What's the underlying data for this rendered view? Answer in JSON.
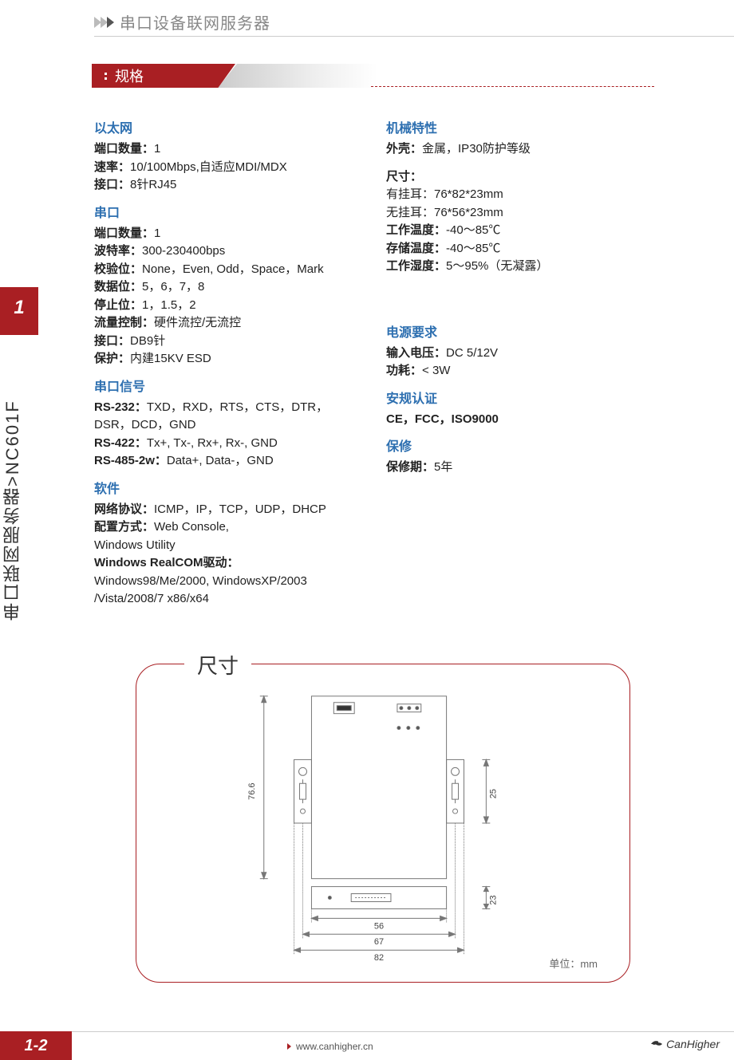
{
  "header": {
    "breadcrumb": "串口设备联网服务器"
  },
  "banner": {
    "title": "规格"
  },
  "sidebar": {
    "chapter": "1",
    "label": "串口联网服务器>NC601F"
  },
  "left": {
    "ethernet": {
      "h": "以太网",
      "l1_label": "端口数量：",
      "l1": "1",
      "l2_label": "速率：",
      "l2": "10/100Mbps,自适应MDI/MDX",
      "l3_label": "接口：",
      "l3": "8针RJ45"
    },
    "serial": {
      "h": "串口",
      "l1_label": "端口数量：",
      "l1": "1",
      "l2_label": "波特率：",
      "l2": "300-230400bps",
      "l3_label": "校验位：",
      "l3": "None，Even, Odd，Space，Mark",
      "l4_label": "数据位：",
      "l4": "5，6，7，8",
      "l5_label": "停止位：",
      "l5": "1，1.5，2",
      "l6_label": "流量控制：",
      "l6": "硬件流控/无流控",
      "l7_label": "接口：",
      "l7": "DB9针",
      "l8_label": "保护：",
      "l8": "内建15KV ESD"
    },
    "signals": {
      "h": "串口信号",
      "l1_label": "RS-232：",
      "l1": "TXD，RXD，RTS，CTS，DTR，DSR，DCD，GND",
      "l2_label": "RS-422：",
      "l2": "Tx+, Tx-, Rx+, Rx-, GND",
      "l3_label": "RS-485-2w：",
      "l3": "Data+, Data-，GND"
    },
    "software": {
      "h": "软件",
      "l1_label": "网络协议：",
      "l1": "ICMP，IP，TCP，UDP，DHCP",
      "l2_label": "配置方式：",
      "l2": "Web Console,",
      "l2b": "Windows Utility",
      "l3_label": "Windows RealCOM驱动：",
      "l3": "",
      "l3b": "Windows98/Me/2000, WindowsXP/2003",
      "l3c": "/Vista/2008/7 x86/x64"
    }
  },
  "right": {
    "mech": {
      "h": "机械特性",
      "l1_label": "外壳：",
      "l1": "金属，IP30防护等级"
    },
    "size": {
      "h": "尺寸：",
      "l1": "有挂耳：76*82*23mm",
      "l2": "无挂耳：76*56*23mm"
    },
    "temp": {
      "l1_label": "工作温度：",
      "l1": "-40～85℃",
      "l2_label": "存储温度：",
      "l2": "-40～85℃",
      "l3_label": "工作湿度：",
      "l3": "5～95%（无凝露）"
    },
    "power": {
      "h": "电源要求",
      "l1_label": "输入电压：",
      "l1": "DC 5/12V",
      "l2_label": "功耗：",
      "l2": "< 3W"
    },
    "cert": {
      "h": "安规认证",
      "l1": "CE，FCC，ISO9000"
    },
    "warranty": {
      "h": "保修",
      "l1_label": "保修期：",
      "l1": "5年"
    }
  },
  "diagram": {
    "title": "尺寸",
    "dim_height": "76.6",
    "dim_inner_w": "56",
    "dim_mid_w": "67",
    "dim_outer_w": "82",
    "dim_ear_h": "25",
    "dim_depth": "23",
    "unit": "单位：mm"
  },
  "footer": {
    "page": "1-2",
    "url": "www.canhigher.cn",
    "brand": "CanHigher"
  }
}
